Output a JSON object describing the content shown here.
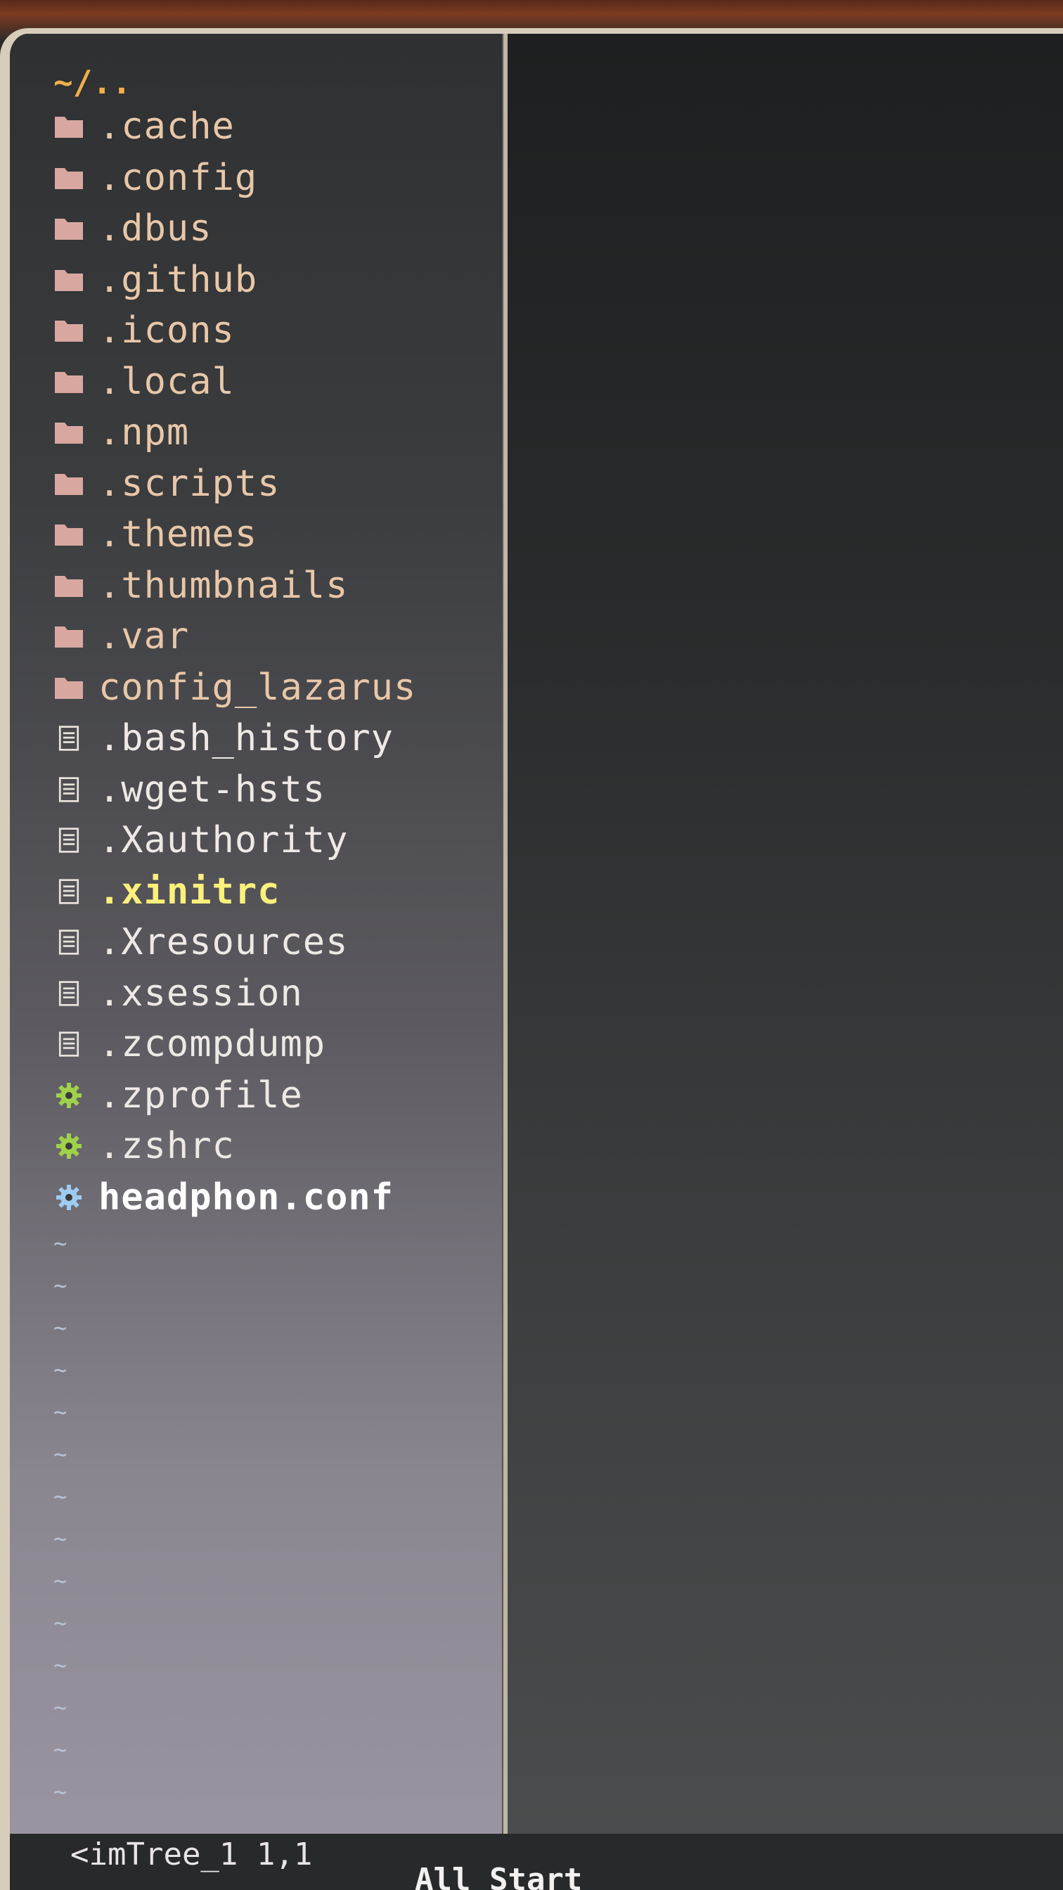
{
  "tree": {
    "header": "~/..",
    "items": [
      {
        "name": ".cache",
        "type": "dir",
        "icon": "folder-icon"
      },
      {
        "name": ".config",
        "type": "dir",
        "icon": "folder-icon"
      },
      {
        "name": ".dbus",
        "type": "dir",
        "icon": "folder-icon"
      },
      {
        "name": ".github",
        "type": "dir",
        "icon": "folder-icon"
      },
      {
        "name": ".icons",
        "type": "dir",
        "icon": "folder-icon"
      },
      {
        "name": ".local",
        "type": "dir",
        "icon": "folder-icon"
      },
      {
        "name": ".npm",
        "type": "dir",
        "icon": "folder-icon"
      },
      {
        "name": ".scripts",
        "type": "dir",
        "icon": "folder-icon"
      },
      {
        "name": ".themes",
        "type": "dir",
        "icon": "folder-icon"
      },
      {
        "name": ".thumbnails",
        "type": "dir",
        "icon": "folder-icon"
      },
      {
        "name": ".var",
        "type": "dir",
        "icon": "folder-icon"
      },
      {
        "name": "config_lazarus",
        "type": "dir",
        "icon": "folder-icon"
      },
      {
        "name": ".bash_history",
        "type": "file",
        "icon": "file-icon"
      },
      {
        "name": ".wget-hsts",
        "type": "file",
        "icon": "file-icon"
      },
      {
        "name": ".Xauthority",
        "type": "file",
        "icon": "file-icon"
      },
      {
        "name": ".xinitrc",
        "type": "file-highlight",
        "icon": "file-icon"
      },
      {
        "name": ".Xresources",
        "type": "file",
        "icon": "file-icon"
      },
      {
        "name": ".xsession",
        "type": "file",
        "icon": "file-icon"
      },
      {
        "name": ".zcompdump",
        "type": "file",
        "icon": "file-icon"
      },
      {
        "name": ".zprofile",
        "type": "gear-green",
        "icon": "gear-icon"
      },
      {
        "name": ".zshrc",
        "type": "gear-green",
        "icon": "gear-icon"
      },
      {
        "name": "headphon.conf",
        "type": "gear-blue",
        "icon": "gear-icon"
      }
    ],
    "tilde_lines": [
      "~",
      "~",
      "~",
      "~",
      "~",
      "~",
      "~",
      "~",
      "~",
      "~",
      "~",
      "~",
      "~",
      "~"
    ]
  },
  "statusline": {
    "buffer_name": "<imTree_1 1,1",
    "position": "All Start"
  },
  "colors": {
    "header": "#f0b04a",
    "folder": "#d8a8a0",
    "gear_green": "#9fd24a",
    "gear_blue": "#9ecbf0"
  }
}
